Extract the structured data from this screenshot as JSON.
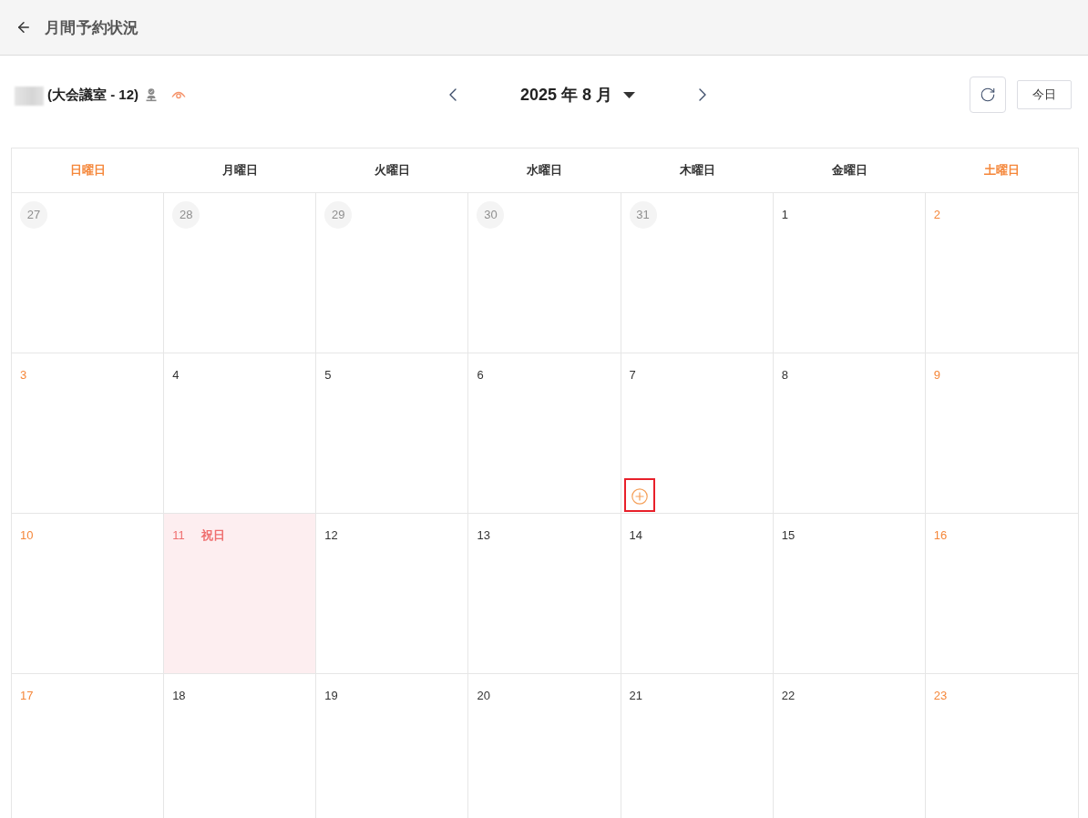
{
  "header": {
    "title": "月間予約状況"
  },
  "room": {
    "label": "(大会議室 - 12)"
  },
  "month_nav": {
    "title": "2025 年 8 月"
  },
  "today_button": {
    "label": "今日"
  },
  "weekdays": [
    {
      "label": "日曜日",
      "kind": "weekend"
    },
    {
      "label": "月曜日",
      "kind": "weekday"
    },
    {
      "label": "火曜日",
      "kind": "weekday"
    },
    {
      "label": "水曜日",
      "kind": "weekday"
    },
    {
      "label": "木曜日",
      "kind": "weekday"
    },
    {
      "label": "金曜日",
      "kind": "weekday"
    },
    {
      "label": "土曜日",
      "kind": "weekend"
    }
  ],
  "weeks": [
    [
      {
        "day": "27",
        "kind": "outside"
      },
      {
        "day": "28",
        "kind": "outside"
      },
      {
        "day": "29",
        "kind": "outside"
      },
      {
        "day": "30",
        "kind": "outside"
      },
      {
        "day": "31",
        "kind": "outside"
      },
      {
        "day": "1",
        "kind": "weekday"
      },
      {
        "day": "2",
        "kind": "weekend"
      }
    ],
    [
      {
        "day": "3",
        "kind": "weekend"
      },
      {
        "day": "4",
        "kind": "weekday"
      },
      {
        "day": "5",
        "kind": "weekday"
      },
      {
        "day": "6",
        "kind": "weekday"
      },
      {
        "day": "7",
        "kind": "weekday",
        "add_button": {
          "highlighted": true
        }
      },
      {
        "day": "8",
        "kind": "weekday"
      },
      {
        "day": "9",
        "kind": "weekend"
      }
    ],
    [
      {
        "day": "10",
        "kind": "weekend"
      },
      {
        "day": "11",
        "kind": "holiday",
        "holiday_label": "祝日"
      },
      {
        "day": "12",
        "kind": "weekday"
      },
      {
        "day": "13",
        "kind": "weekday"
      },
      {
        "day": "14",
        "kind": "weekday"
      },
      {
        "day": "15",
        "kind": "weekday"
      },
      {
        "day": "16",
        "kind": "weekend"
      }
    ],
    [
      {
        "day": "17",
        "kind": "weekend"
      },
      {
        "day": "18",
        "kind": "weekday"
      },
      {
        "day": "19",
        "kind": "weekday"
      },
      {
        "day": "20",
        "kind": "weekday"
      },
      {
        "day": "21",
        "kind": "weekday"
      },
      {
        "day": "22",
        "kind": "weekday"
      },
      {
        "day": "23",
        "kind": "weekend"
      }
    ]
  ]
}
